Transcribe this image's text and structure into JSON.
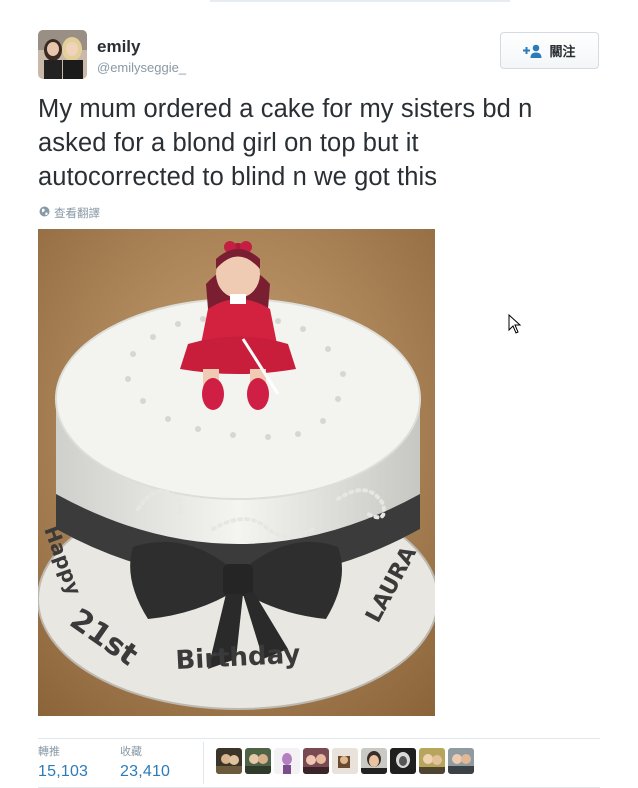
{
  "user": {
    "name": "emily",
    "handle": "@emilyseggie_"
  },
  "follow_button": {
    "label": "關注",
    "icon": "add-user-icon"
  },
  "tweet": {
    "text_lines": [
      "My mum ordered a cake for my sisters bd n",
      "asked for a blond girl on top but it",
      "autocorrected to blind n we got this"
    ],
    "translate_label": "查看翻譯"
  },
  "photo": {
    "cake_text_left": "Happy",
    "cake_text_number": "21st",
    "cake_text_bottom": "Birthday",
    "cake_text_right": "LAURA"
  },
  "stats": {
    "retweets_label": "轉推",
    "retweets_value": "15,103",
    "likes_label": "收藏",
    "likes_value": "23,410"
  },
  "colors": {
    "link": "#2b7bb9",
    "muted": "#8899a6",
    "text": "#292f33"
  }
}
